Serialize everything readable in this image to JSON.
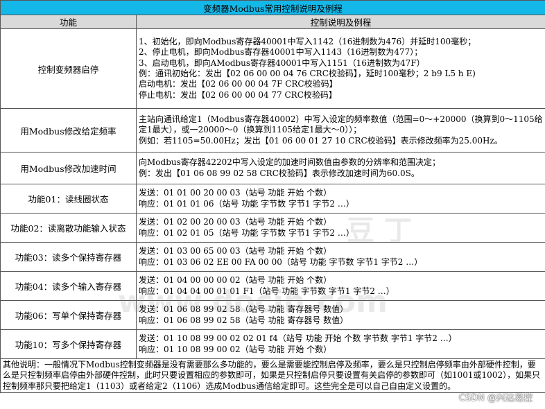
{
  "title": "变频器Modbus常用控制说明及例程",
  "headers": {
    "function": "功能",
    "description": "控制说明及例程"
  },
  "rows": [
    {
      "function": "控制变频器启停",
      "lines": [
        "1、初始化，即向Modbus寄存器40001中写入1142（16进制数为476）并延时100毫秒；",
        "2、停止电机，即向Modbus寄存器40001中写入1143（16进制数为477）；",
        "3、启动电机，即向AModbus寄存器40001中写入1151（16进制数为47F）",
        "例：通讯初始化：发出【02 06 00 00 04 76 CRC校验码】，延时100毫秒；2 b9 L5 h E)",
        "启动电机：发出【02 06 00 00 04 7F CRC校验码】",
        "停止电机：发出【02 06 00 00 04 77 CRC校验码】"
      ]
    },
    {
      "function": "用Modbus修改给定频率",
      "lines": [
        "主站向通讯给定1（Modbus寄存器40002）中写入设定的频率数值（范围=0～+20000（换算到0～1105给定1最大），或一20000～0（换算到1105给定1最大～0））；",
        "例如：若1105=50.00Hz；发出【01 06 00 01 27 10 CRC校验码】表示修改频率为25.00Hz。"
      ]
    },
    {
      "function": "用Modbus修改加速时间",
      "lines": [
        "向Modbus寄存器42202中写入设定的加速时间数值由参数的分辨率和范围决定；",
        "例：发出【01 06 08 99 02 58 CRC校验码】表示修改加速时间为60.0S。"
      ]
    },
    {
      "function": "功能01：读线圈状态",
      "lines": [
        "发送：01 01 00 20 00 03（站号 功能 开始 个数）",
        "响应：01 01 01 06（站号 功能 字节数 字节1 字节2 …）"
      ]
    },
    {
      "function": "功能02：读离散功能输入状态",
      "lines": [
        "发送：01 02 00 20 00 03（站号 功能 开始 个数）",
        "响应：01 02 01 05（站号 功能 字节数 字节1 字节2 …）"
      ]
    },
    {
      "function": "功能03：读多个保持寄存器",
      "lines": [
        "发送：01 03 00 65 00 03（站号 功能 开始 个数）",
        "响应：01 03 06 02 EE 00 FA 00 00（站号 功能 字节数 字节1 字节2 …）"
      ]
    },
    {
      "function": "功能04：读多个输入寄存器",
      "lines": [
        "发送：01 04 00 00 00 02（站号 功能 开始 个数）",
        "响应：01 04 04 00 01 01 F1（站号 功能 字节数 字节1 字节2 …）"
      ]
    },
    {
      "function": "功能06：写单个保持寄存器",
      "lines": [
        "发送：01 06 08 99 02 58（站号 功能 寄存器号 数值）",
        "响应：01 06 08 99 02 58（站号 功能 寄存器号 数值）"
      ]
    },
    {
      "function": "功能10：写多个保持寄存器",
      "lines": [
        "发送：01 10 08 99 00 02 02 01 f4（站号 功能 开始 个数 字节数 字节1 字节2 …）",
        "响应：01 10 08 99 00 02（站号 功能 开始 个数）"
      ]
    }
  ],
  "note": "其他说明：一般情况下Modbus控制变频器是没有需要那么多功能的，要么是需要能控制启停及频率，要么是只控制启停频率由外部硬件控制，要么是只控制频率启停由外部硬件控制，此时只要设置相应的参数即可，如果是只控制启停只要设置有关启停的参数即可（如1001或1002），如果只控制频率那只要把给定1（1103）或者给定2（1106）选成Modbus通信给定即可。这些完全是可以自己自由定义设置的。",
  "watermark": {
    "text1": "豆丁",
    "text2": "www.docin.com"
  },
  "credit": "CSDN @兴达易控"
}
